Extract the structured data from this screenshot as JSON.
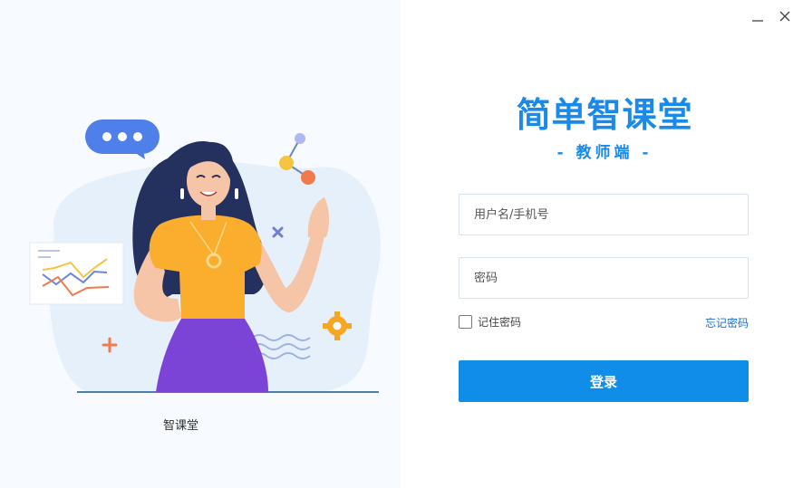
{
  "window": {
    "minimize_icon": "minimize-icon",
    "close_icon": "close-icon"
  },
  "illustration": {
    "caption": "智课堂"
  },
  "brand": {
    "title": "简单智课堂",
    "subtitle": "- 教师端 -",
    "color": "#1a8aea"
  },
  "form": {
    "username_placeholder": "用户名/手机号",
    "password_placeholder": "密码",
    "remember_label": "记住密码",
    "forgot_label": "忘记密码",
    "login_label": "登录",
    "login_color": "#0f8de8"
  }
}
